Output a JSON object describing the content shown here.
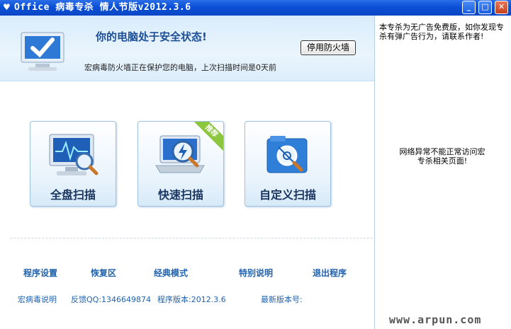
{
  "window": {
    "title": "Office 病毒专杀 情人节版v2012.3.6",
    "controls": {
      "minimize": "_",
      "maximize": "□",
      "close": "✕"
    }
  },
  "status": {
    "title": "你的电脑处于安全状态!",
    "subtitle": "宏病毒防火墙正在保护您的电脑，上次扫描时间是0天前",
    "firewall_button": "停用防火墙",
    "icon": "monitor-check-icon"
  },
  "scan_options": [
    {
      "label": "全盘扫描",
      "icon": "monitor-pulse-icon"
    },
    {
      "label": "快速扫描",
      "icon": "laptop-lightning-icon",
      "badge": "推荐"
    },
    {
      "label": "自定义扫描",
      "icon": "folder-target-icon"
    }
  ],
  "links": [
    {
      "label": "程序设置"
    },
    {
      "label": "恢复区"
    },
    {
      "label": "经典模式"
    },
    {
      "label": "特别说明"
    },
    {
      "label": "退出程序"
    }
  ],
  "info": {
    "help": "宏病毒说明",
    "feedback": "反馈QQ:1346649874",
    "version": "程序版本:2012.3.6",
    "latest": "最新版本号:"
  },
  "side": {
    "notice": "本专杀为无广告免费版，如你发现专杀有弹广告行为，请联系作者!",
    "error": "网络异常不能正常访问宏专杀相关页面!",
    "watermark": "www.arpun.com"
  },
  "colors": {
    "titlebar": "#0b4fd6",
    "accent": "#2163ad",
    "badge": "#8cc63f"
  }
}
